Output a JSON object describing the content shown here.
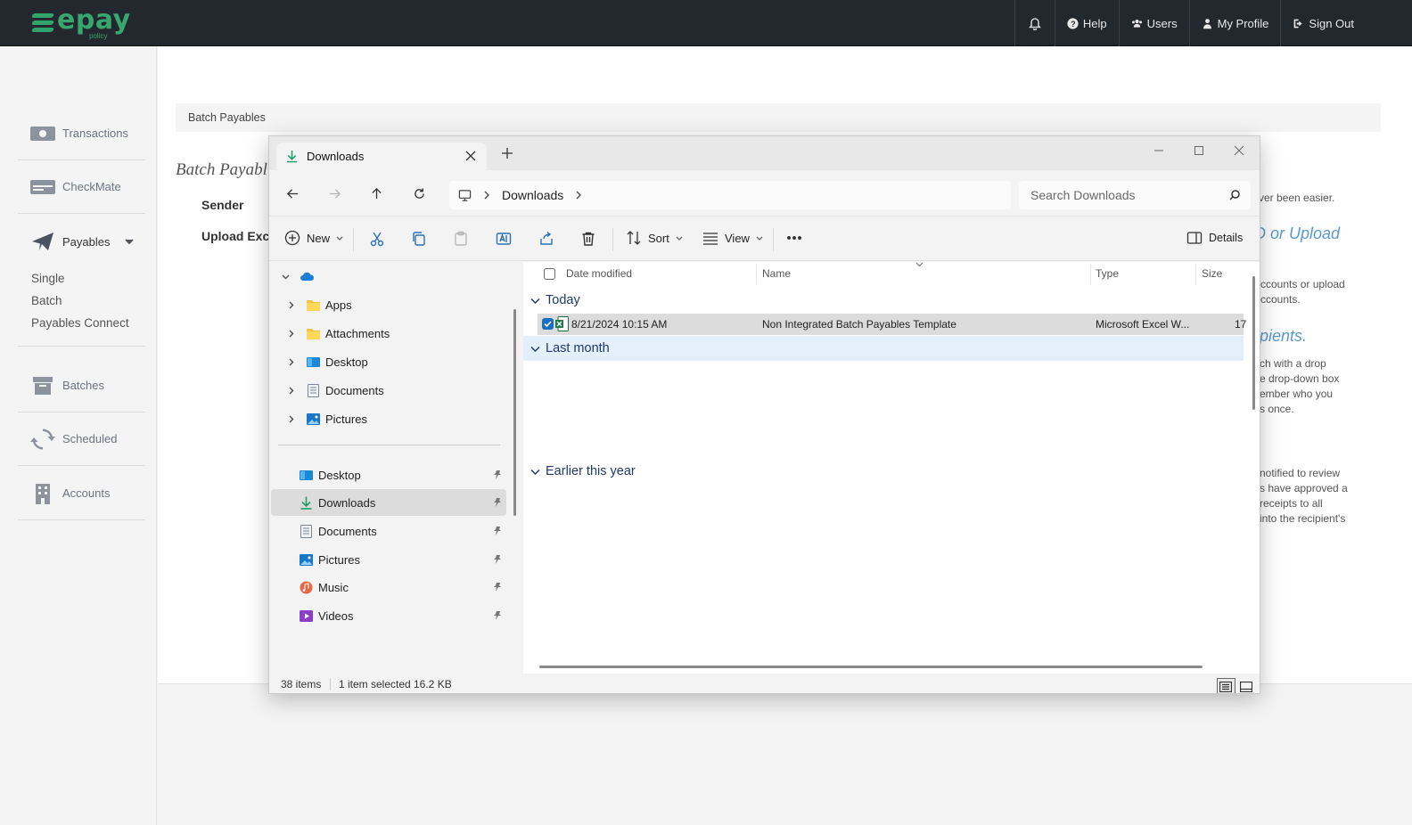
{
  "app": {
    "brand": "epay",
    "brand_sub": "policy",
    "topnav": [
      {
        "label": "Help",
        "icon": "question-circle-icon"
      },
      {
        "label": "Users",
        "icon": "users-icon"
      },
      {
        "label": "My Profile",
        "icon": "user-icon"
      },
      {
        "label": "Sign Out",
        "icon": "sign-out-icon"
      }
    ]
  },
  "sidebar": {
    "items": [
      {
        "label": "Transactions",
        "icon": "cash-icon"
      },
      {
        "label": "CheckMate",
        "icon": "check-icon"
      },
      {
        "label": "Payables",
        "icon": "paper-plane-icon"
      },
      {
        "label": "Batches",
        "icon": "archive-icon"
      },
      {
        "label": "Scheduled",
        "icon": "sync-icon"
      },
      {
        "label": "Accounts",
        "icon": "building-icon"
      }
    ],
    "payables_sub": [
      "Single",
      "Batch",
      "Payables Connect"
    ]
  },
  "main": {
    "breadcrumb": "Batch Payables",
    "title": "Batch Payabl",
    "sender_label": "Sender",
    "upload_label": "Upload Exce",
    "right": {
      "line1": "ver been easier.",
      "heading1": "D or Upload",
      "p1a": "ccounts or upload",
      "p1b": "ccounts.",
      "heading2": "pients.",
      "p2a": "ch with a drop",
      "p2b": "e drop-down box",
      "p2c": "ember who you",
      "p2d": "s once.",
      "p3a": "notified to review",
      "p3b": "s have approved a",
      "p3c": "receipts to all",
      "p3d": "into the recipient's"
    }
  },
  "explorer": {
    "tab_title": "Downloads",
    "address_crumb": "Downloads",
    "search_placeholder": "Search Downloads",
    "commands": {
      "new": "New",
      "sort": "Sort",
      "view": "View",
      "details": "Details"
    },
    "nav_tree": [
      {
        "label": "Apps",
        "icon": "folder-icon"
      },
      {
        "label": "Attachments",
        "icon": "folder-icon"
      },
      {
        "label": "Desktop",
        "icon": "desktop-icon"
      },
      {
        "label": "Documents",
        "icon": "documents-icon"
      },
      {
        "label": "Pictures",
        "icon": "pictures-icon"
      }
    ],
    "quick_access": [
      {
        "label": "Desktop",
        "icon": "desktop-icon"
      },
      {
        "label": "Downloads",
        "icon": "download-icon"
      },
      {
        "label": "Documents",
        "icon": "documents-icon"
      },
      {
        "label": "Pictures",
        "icon": "pictures-icon"
      },
      {
        "label": "Music",
        "icon": "music-icon"
      },
      {
        "label": "Videos",
        "icon": "videos-icon"
      }
    ],
    "columns": [
      "Date modified",
      "Name",
      "Type",
      "Size"
    ],
    "groups": [
      "Today",
      "Last month",
      "Earlier this year"
    ],
    "selected_file": {
      "date": "8/21/2024 10:15 AM",
      "name": "Non Integrated Batch Payables Template",
      "type": "Microsoft Excel W...",
      "size": "17"
    },
    "status": {
      "count": "38 items",
      "selected": "1 item selected",
      "size": "16.2 KB"
    }
  },
  "colors": {
    "topbar": "#23282f",
    "brand_green": "#37a76f",
    "accent_blue": "#5a9ac7",
    "selection": "#dcdcdc"
  }
}
